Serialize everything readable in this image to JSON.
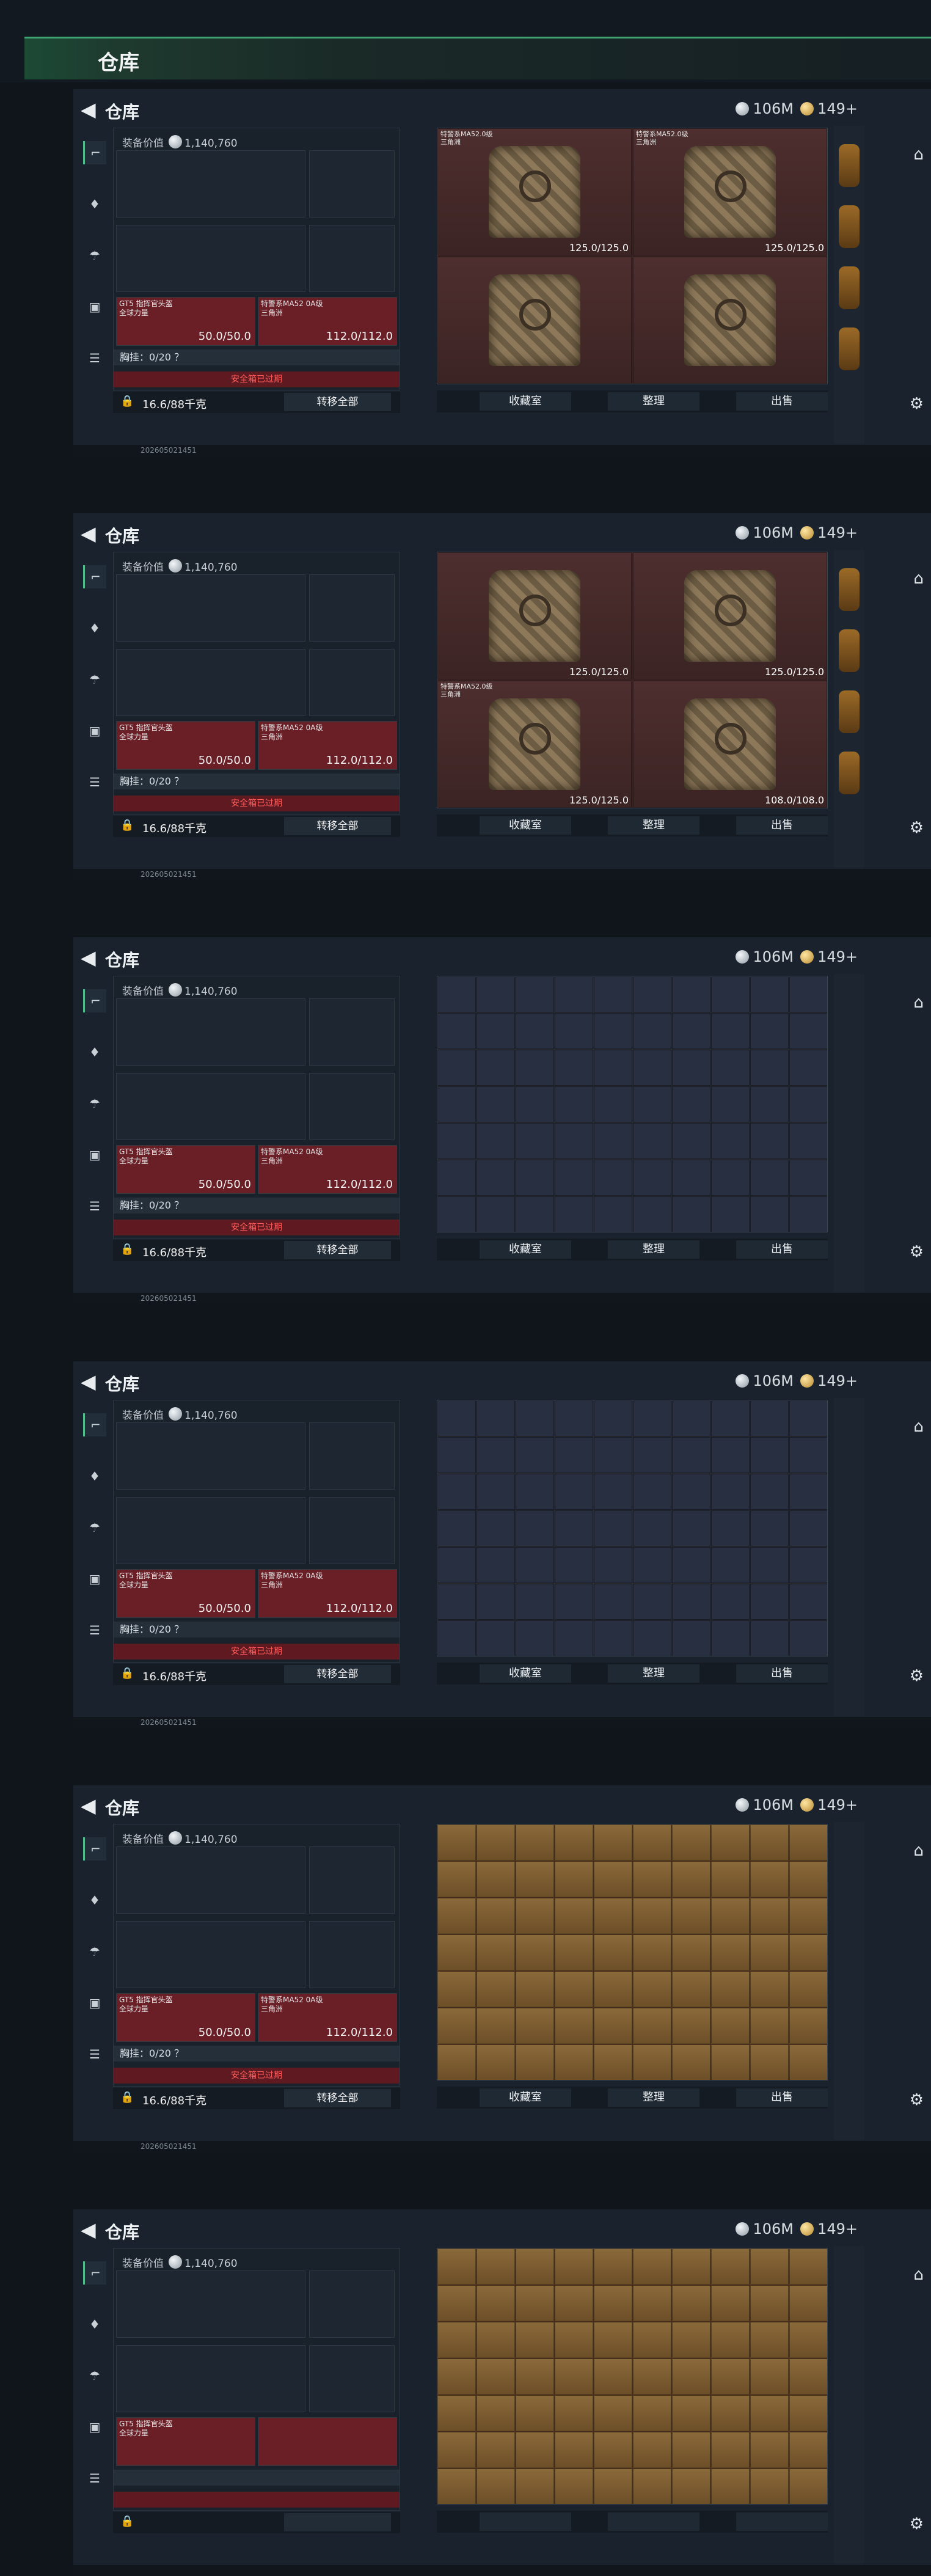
{
  "header": {
    "title": "仓库"
  },
  "shots": [
    {
      "money": "106M",
      "tokens": "149+",
      "title": "仓库",
      "equip_label": "装备价值",
      "equip_value": "1,140,760",
      "helmet_name": "GT5 指挥官头盔\n全球力量",
      "armor_name": "特警系MA52 0A级\n三角洲",
      "helmet_val": "50.0/50.0",
      "armor_val": "112.0/112.0",
      "chest": "胸挂：0/20  ？",
      "safe": "安全箱已过期",
      "weight": "16.6/88千克",
      "transfer": "转移全部",
      "actions": [
        "收藏室",
        "整理",
        "出售"
      ],
      "timestamp": "202605021451",
      "stash_type": "armor",
      "stash_items": [
        {
          "name": "特警系MA52.0级\n三角洲",
          "count": "125.0/125.0"
        },
        {
          "name": "特警系MA52.0级\n三角洲",
          "count": "125.0/125.0"
        },
        {
          "name": "",
          "count": ""
        },
        {
          "name": "",
          "count": ""
        }
      ]
    },
    {
      "money": "106M",
      "tokens": "149+",
      "title": "仓库",
      "equip_label": "装备价值",
      "equip_value": "1,140,760",
      "helmet_name": "GT5 指挥官头盔\n全球力量",
      "armor_name": "特警系MA52 0A级\n三角洲",
      "helmet_val": "50.0/50.0",
      "armor_val": "112.0/112.0",
      "chest": "胸挂：0/20  ？",
      "safe": "安全箱已过期",
      "weight": "16.6/88千克",
      "transfer": "转移全部",
      "actions": [
        "收藏室",
        "整理",
        "出售"
      ],
      "timestamp": "202605021451",
      "stash_type": "armor",
      "stash_items": [
        {
          "name": "",
          "count": "125.0/125.0"
        },
        {
          "name": "",
          "count": "125.0/125.0"
        },
        {
          "name": "特警系MA52.0级\n三角洲",
          "count": "125.0/125.0"
        },
        {
          "name": "",
          "count": "108.0/108.0"
        }
      ]
    },
    {
      "money": "106M",
      "tokens": "149+",
      "title": "仓库",
      "equip_label": "装备价值",
      "equip_value": "1,140,760",
      "helmet_name": "GT5 指挥官头盔\n全球力量",
      "armor_name": "特警系MA52 0A级\n三角洲",
      "helmet_val": "50.0/50.0",
      "armor_val": "112.0/112.0",
      "chest": "胸挂：0/20  ？",
      "safe": "安全箱已过期",
      "weight": "16.6/88千克",
      "transfer": "转移全部",
      "actions": [
        "收藏室",
        "整理",
        "出售"
      ],
      "timestamp": "202605021451",
      "stash_type": "meds",
      "stash_items": []
    },
    {
      "money": "106M",
      "tokens": "149+",
      "title": "仓库",
      "equip_label": "装备价值",
      "equip_value": "1,140,760",
      "helmet_name": "GT5 指挥官头盔\n全球力量",
      "armor_name": "特警系MA52 0A级\n三角洲",
      "helmet_val": "50.0/50.0",
      "armor_val": "112.0/112.0",
      "chest": "胸挂：0/20  ？",
      "safe": "安全箱已过期",
      "weight": "16.6/88千克",
      "transfer": "转移全部",
      "actions": [
        "收藏室",
        "整理",
        "出售"
      ],
      "timestamp": "202605021451",
      "stash_type": "meds",
      "stash_items": []
    },
    {
      "money": "106M",
      "tokens": "149+",
      "title": "仓库",
      "equip_label": "装备价值",
      "equip_value": "1,140,760",
      "helmet_name": "GT5 指挥官头盔\n全球力量",
      "armor_name": "特警系MA52 0A级\n三角洲",
      "helmet_val": "50.0/50.0",
      "armor_val": "112.0/112.0",
      "chest": "胸挂：0/20  ？",
      "safe": "安全箱已过期",
      "weight": "16.6/88千克",
      "transfer": "转移全部",
      "actions": [
        "收藏室",
        "整理",
        "出售"
      ],
      "timestamp": "202605021451",
      "stash_type": "ammo",
      "stash_items": []
    },
    {
      "money": "106M",
      "tokens": "149+",
      "title": "仓库",
      "equip_label": "装备价值",
      "equip_value": "1,140,760",
      "helmet_name": "GT5 指挥官头盔\n全球力量",
      "armor_name": "",
      "helmet_val": "",
      "armor_val": "",
      "chest": "",
      "safe": "",
      "weight": "",
      "transfer": "",
      "actions": [
        "",
        "",
        ""
      ],
      "timestamp": "",
      "stash_type": "ammo",
      "stash_items": []
    }
  ]
}
